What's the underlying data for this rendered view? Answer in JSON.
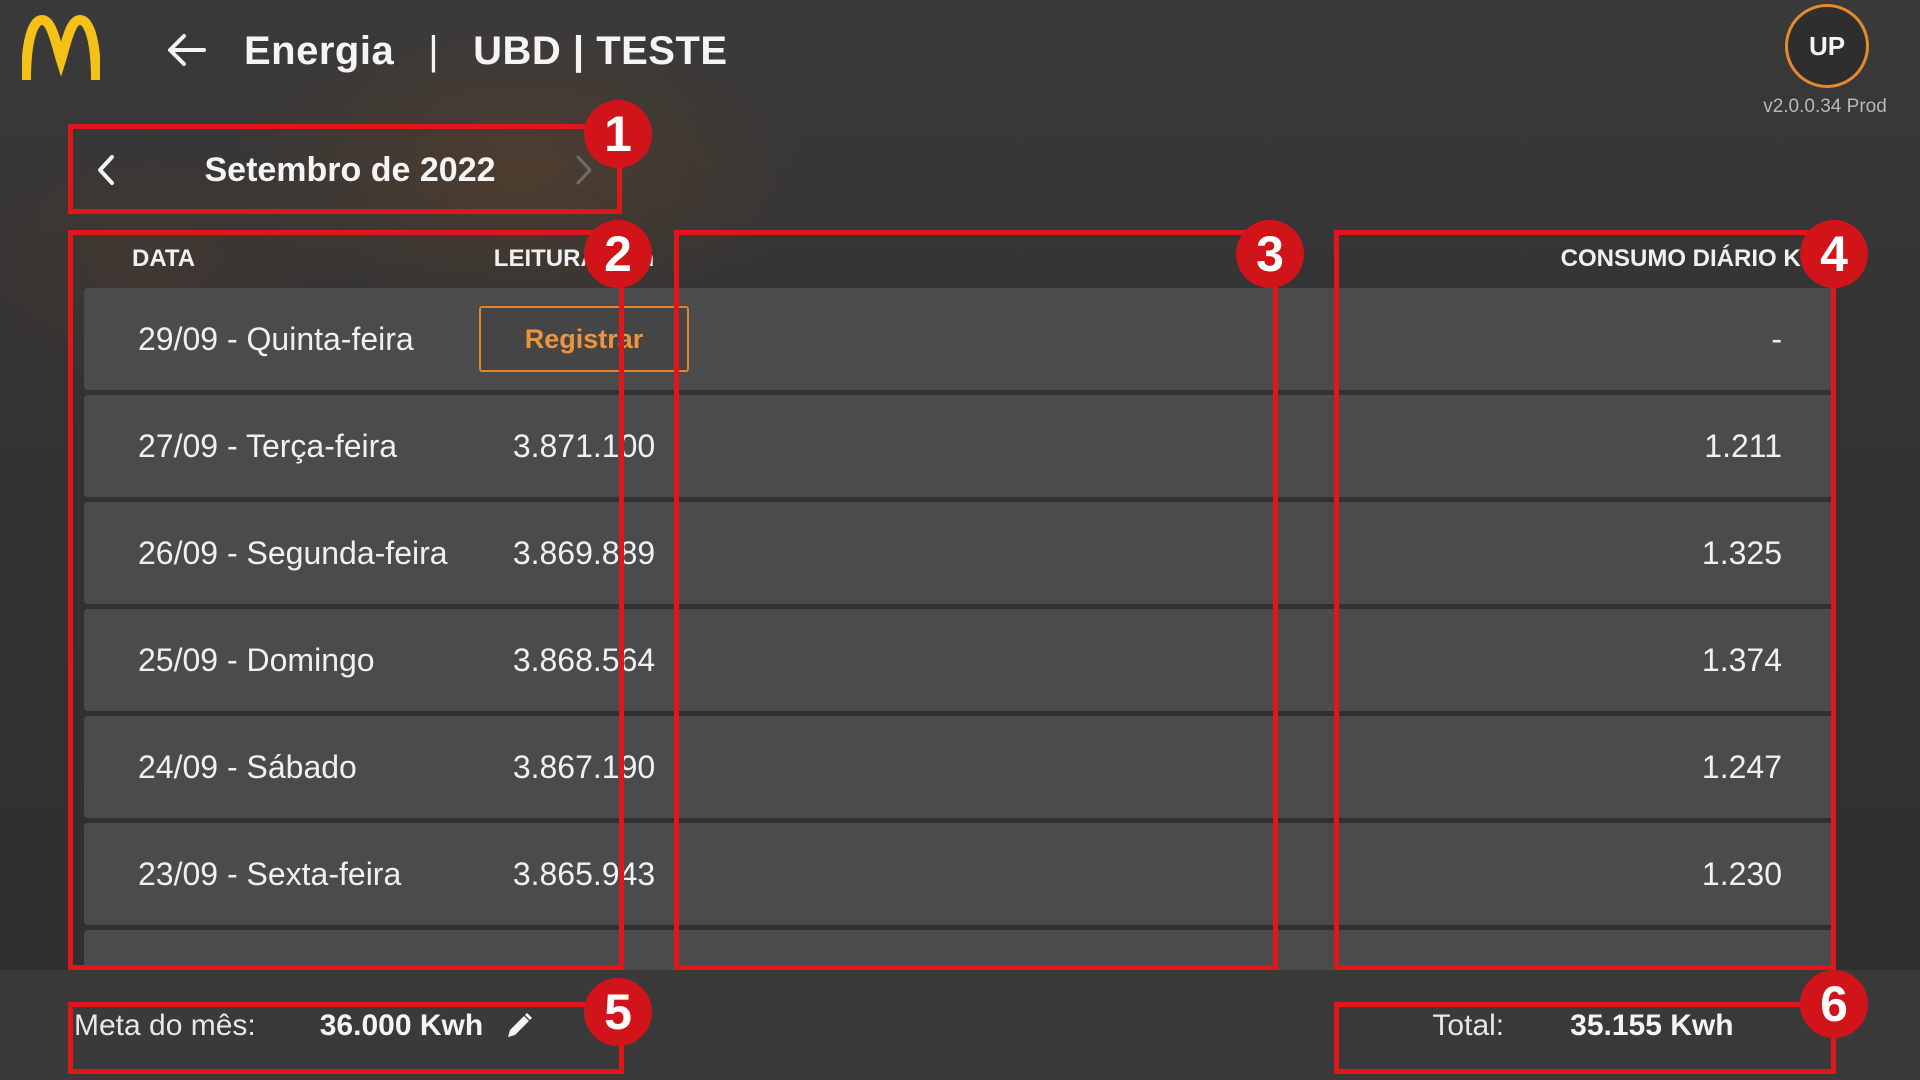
{
  "header": {
    "title": "Energia",
    "separator": "|",
    "subtitle": "UBD | TESTE",
    "avatar_initials": "UP",
    "version": "v2.0.0.34 Prod",
    "logo_icon": "mcdonalds-arches-logo",
    "back_icon": "arrow-left-icon"
  },
  "month_selector": {
    "label": "Setembro de 2022",
    "prev_icon": "chevron-left-icon",
    "next_icon": "chevron-right-icon"
  },
  "table": {
    "columns": [
      "DATA",
      "LEITURA Kwh",
      "CONSUMO DIÁRIO Kwh"
    ],
    "rows": [
      {
        "date": "29/09 - Quinta-feira",
        "reading": "Registrar",
        "consumption": "-"
      },
      {
        "date": "27/09 - Terça-feira",
        "reading": "3.871.100",
        "consumption": "1.211"
      },
      {
        "date": "26/09 - Segunda-feira",
        "reading": "3.869.889",
        "consumption": "1.325"
      },
      {
        "date": "25/09 - Domingo",
        "reading": "3.868.564",
        "consumption": "1.374"
      },
      {
        "date": "24/09 - Sábado",
        "reading": "3.867.190",
        "consumption": "1.247"
      },
      {
        "date": "23/09 - Sexta-feira",
        "reading": "3.865.943",
        "consumption": "1.230"
      }
    ]
  },
  "footer": {
    "meta_label": "Meta do mês:",
    "meta_value": "36.000 Kwh",
    "edit_icon": "pencil-icon",
    "total_label": "Total:",
    "total_value": "35.155 Kwh"
  },
  "annotations": [
    "1",
    "2",
    "3",
    "4",
    "5",
    "6"
  ],
  "colors": {
    "accent": "#e58a2e",
    "annotation": "#e0161b",
    "background": "#333333",
    "row": "#4b4b4b",
    "logo": "#f5c117"
  }
}
